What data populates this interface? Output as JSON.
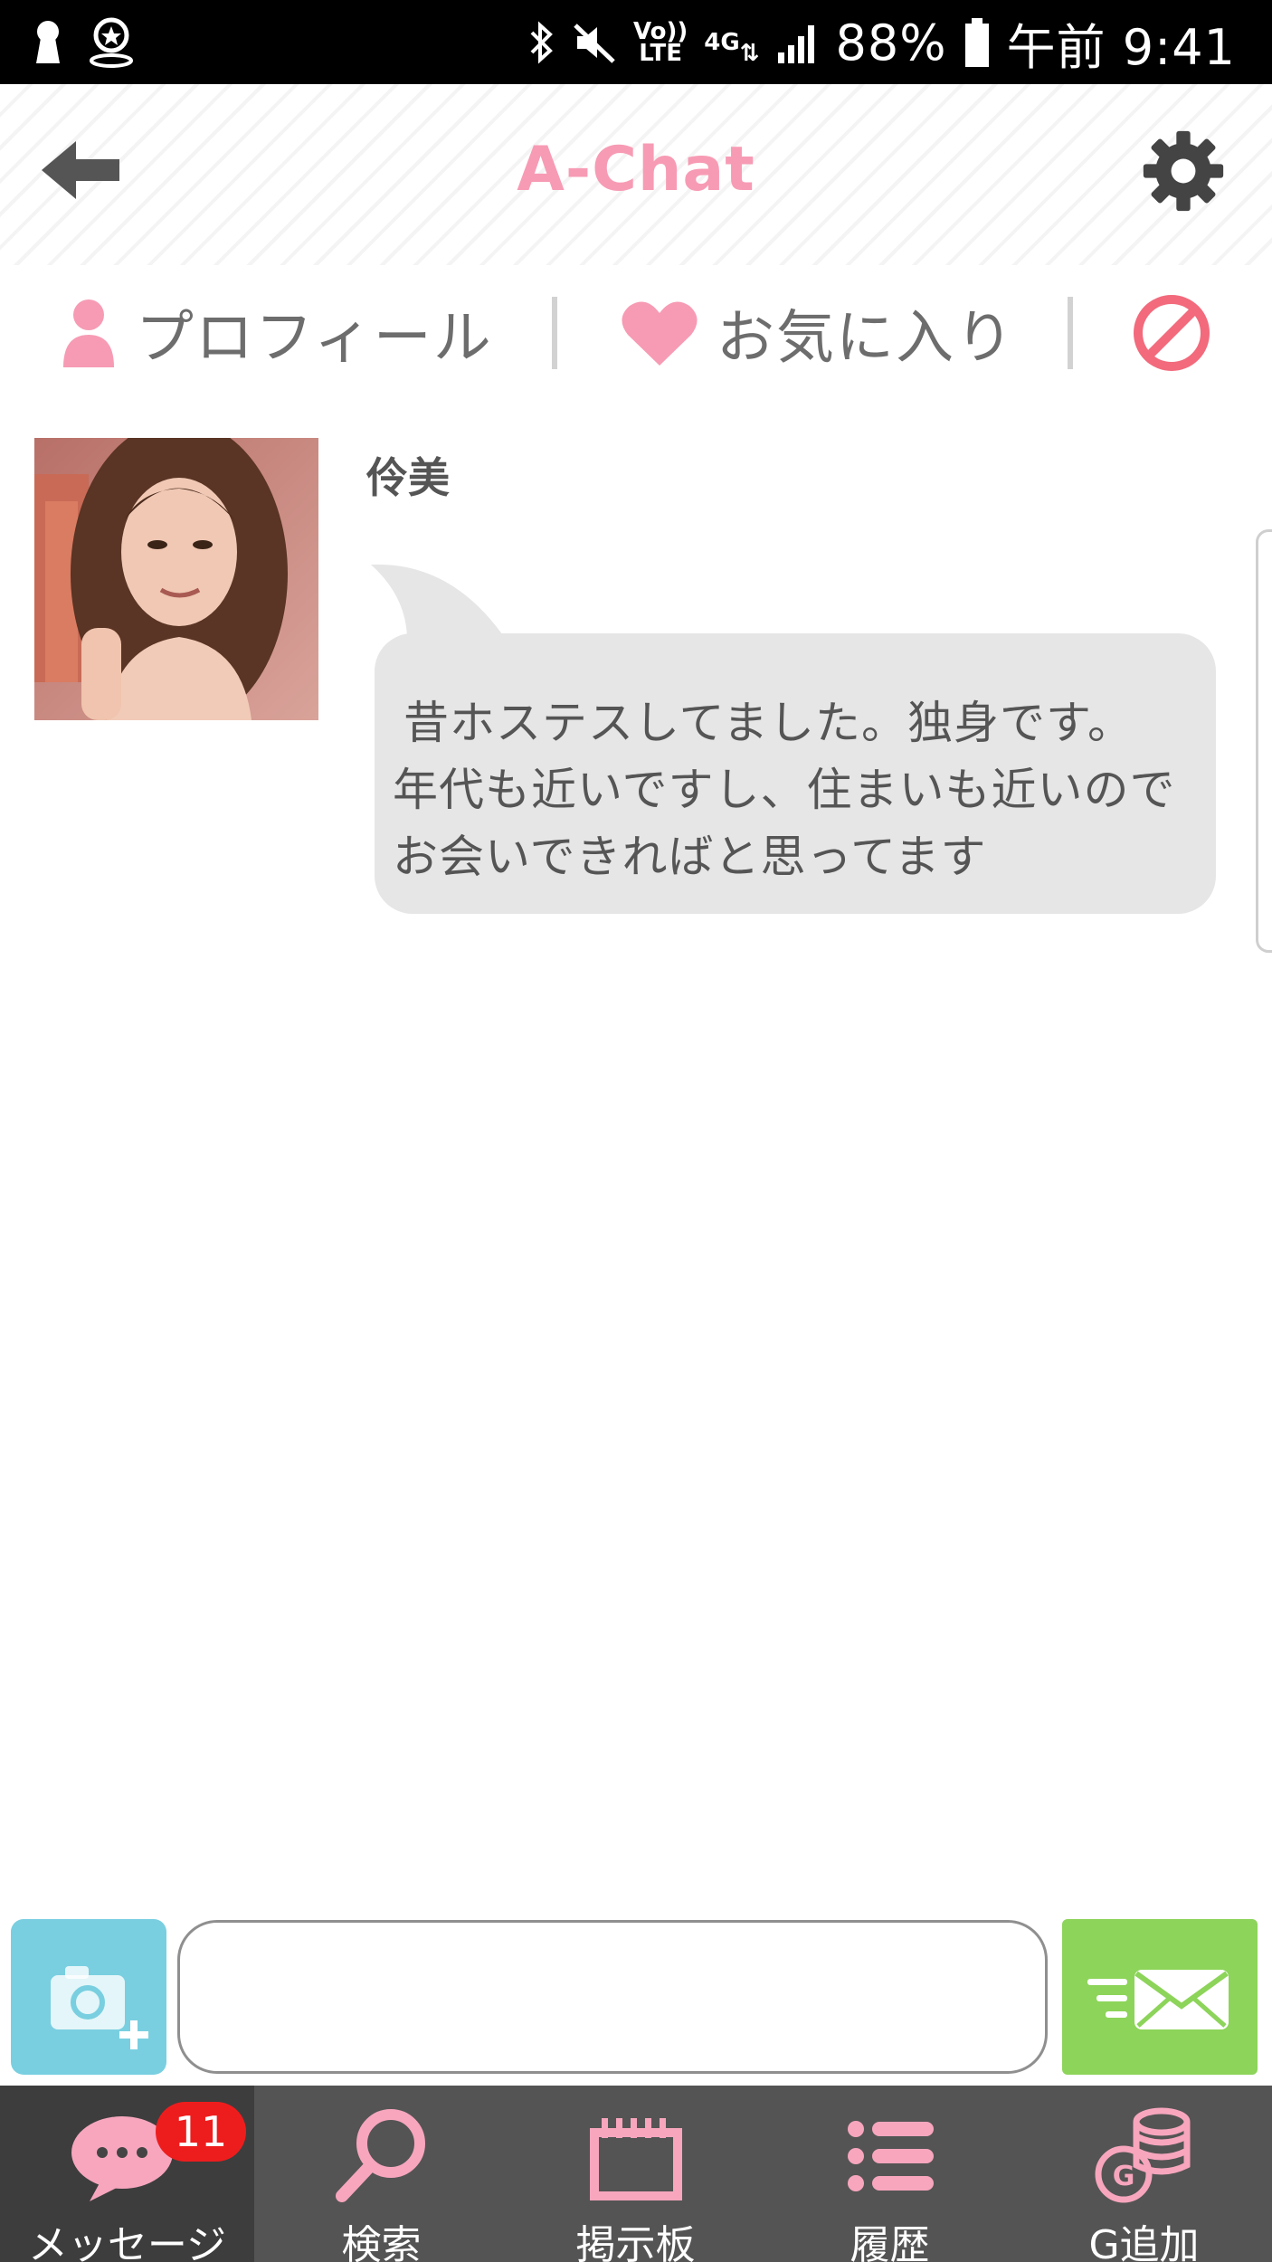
{
  "status_bar": {
    "battery": "88%",
    "time": "午前 9:41",
    "volte_label": "Vo)) LTE",
    "network_label": "4G"
  },
  "header": {
    "title": "A-Chat"
  },
  "actions": {
    "profile_label": "プロフィール",
    "favorite_label": "お気に入り"
  },
  "message": {
    "sender": "伶美",
    "lines": [
      "昔ホステスしてました。独身です。",
      "年代も近いですし、住まいも近いので",
      "お会いできればと思ってます"
    ]
  },
  "composer": {
    "input_value": "",
    "placeholder": ""
  },
  "nav": {
    "items": [
      {
        "label": "メッセージ",
        "badge": "11"
      },
      {
        "label": "検索"
      },
      {
        "label": "掲示板"
      },
      {
        "label": "履歴"
      },
      {
        "label": "G追加"
      }
    ]
  },
  "colors": {
    "accent_pink": "#f79bb4",
    "camera_blue": "#79cfe0",
    "send_green": "#8dd45a",
    "nav_bg": "#545454",
    "badge_red": "#ee1d1d"
  }
}
